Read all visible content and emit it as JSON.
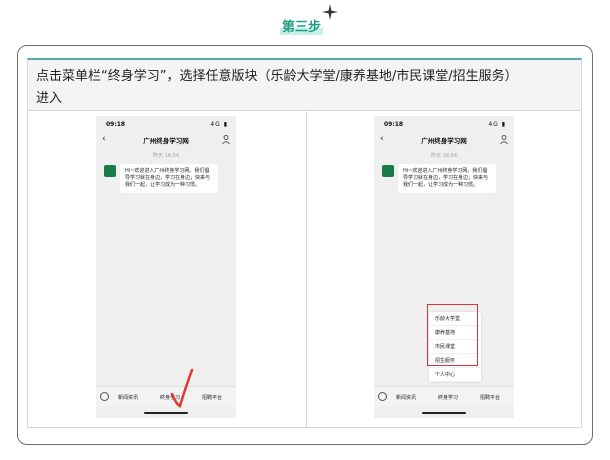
{
  "step": {
    "title": "第三步"
  },
  "instruction": {
    "line1": "点击菜单栏“终身学习”，选择任意版块（乐龄大学堂/康养基地/市民课堂/招生服务）",
    "line2": "进入"
  },
  "phone_left": {
    "time": "09:18",
    "signal": "4G",
    "title": "广州终身学习网",
    "timestamp": "昨天 16:54",
    "message": "Hi~欢迎进入广州终身学习网。我们倡导学习就在身边，学习在身边；快来与我们一起，让学习成为一种习惯。",
    "menu": [
      "新闻资讯",
      "终身学习",
      "招聘平台"
    ]
  },
  "phone_right": {
    "time": "09:18",
    "signal": "4G",
    "title": "广州终身学习网",
    "timestamp": "昨天 16:54",
    "message": "Hi~欢迎进入广州终身学习网。我们倡导学习就在身边，学习在身边；快来与我们一起，让学习成为一种习惯。",
    "submenu": [
      "乐龄大学堂",
      "康养基地",
      "市民课堂",
      "招生服务",
      "个人中心"
    ],
    "menu": [
      "新闻资讯",
      "终身学习",
      "招聘平台"
    ]
  },
  "colors": {
    "accent": "#1f9c86",
    "highlight": "#d8343a",
    "avatar": "#1a7a4a"
  }
}
